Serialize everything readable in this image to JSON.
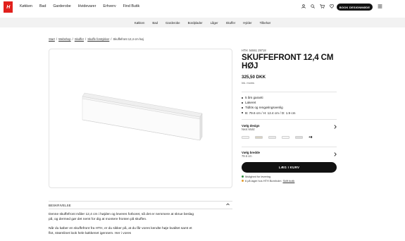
{
  "header": {
    "logo_text": "H",
    "nav": [
      "Køkken",
      "Bad",
      "Garderobe",
      "Hvidevarer",
      "Erhverv",
      "Find Butik"
    ],
    "cta_label": "BOOK DESIGNMØDE"
  },
  "subnav": [
    "Køkken",
    "Bad",
    "Garderobe",
    "Bordplader",
    "Låger",
    "Skuffer",
    "Hylder",
    "Tilbehør"
  ],
  "breadcrumb": {
    "items": [
      "Start",
      "Webshop",
      "Skuffer",
      "Skuffe forstykker"
    ],
    "separator": "/",
    "current": "Skuffefront 12,4 cm høj"
  },
  "product": {
    "sku": "HTH: 54661 29718",
    "title": "SKUFFEFRONT 12,4 CM HØJ",
    "price": "325,50 DKK",
    "vat_note": "Ink. moms",
    "bullets": [
      "5 års garanti",
      "Lakeret",
      "Tidlös og rengøringsvenlig",
      "B: 79.6 cm / H: 12.4 cm / D: 1.9 cm"
    ],
    "design_label": "Vælg design",
    "design_value": "Next Mold",
    "swatch_more": "+8",
    "width_label": "Vælg bredde",
    "width_value": "79.6 cm",
    "buy_label": "LÆG I KURV",
    "delivery": "Mulighed for levering",
    "stock_prefix": "6 på lager hos HTH Bornholm",
    "stock_link": "Skift butik"
  },
  "description": {
    "heading": "BESKRIVELSE",
    "paragraphs": [
      "Denne skuffefront måler 12,4 cm i højden og leveres forboret, så det er nemmere at skrue beslag på, og dermed gør det nemt for dig at montere fronten på skuffen.",
      "Når du køber en skuffefront fra HTH, er du sikker på, at du får vores kendte høje kvalitet samt et flot, strømlinet look hele køkkenet igennem. Her i vores"
    ]
  },
  "colors": {
    "accent": "#e1201c",
    "dark": "#111111",
    "stock_green": "#2e8b3e",
    "stock_orange": "#e39b2a"
  }
}
